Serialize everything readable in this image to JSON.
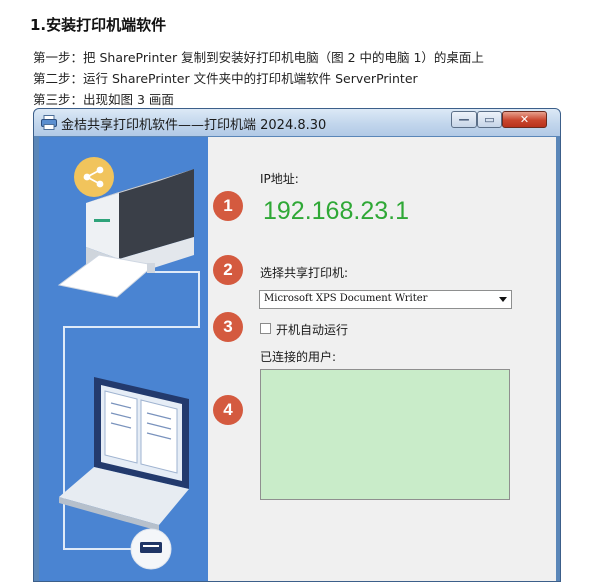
{
  "doc": {
    "heading": "1.安装打印机端软件",
    "steps": [
      "第一步：把 SharePrinter 复制到安装好打印机电脑（图 2 中的电脑 1）的桌面上",
      "第二步：运行 SharePrinter 文件夹中的打印机端软件 ServerPrinter",
      "第三步：出现如图 3 画面"
    ]
  },
  "window": {
    "title": "金桔共享打印机软件——打印机端 2024.8.30",
    "buttons": {
      "minimize": "—",
      "maximize": "▭",
      "close": "✕"
    }
  },
  "form": {
    "ip_label": "IP地址:",
    "ip_value": "192.168.23.1",
    "printer_label": "选择共享打印机:",
    "printer_selected": "Microsoft XPS Document Writer",
    "autorun_label": "开机自动运行",
    "autorun_checked": false,
    "users_label": "已连接的用户:",
    "connected_users": []
  },
  "markers": [
    "1",
    "2",
    "3",
    "4"
  ],
  "colors": {
    "ip_text": "#2fa836",
    "marker": "#d45a3f",
    "users_box": "#c9ecc9",
    "illustration_bg": "#4a84d2"
  },
  "icons": [
    "share-icon",
    "printer-icon",
    "laptop-icon",
    "app-printer-icon"
  ]
}
